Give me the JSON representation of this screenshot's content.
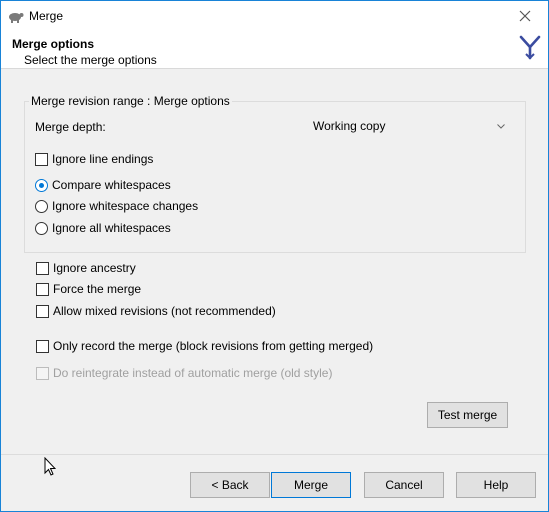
{
  "window": {
    "title": "Merge",
    "app_icon": "tortoise-icon",
    "close_icon": "close-icon"
  },
  "header": {
    "title": "Merge options",
    "subtitle": "Select the merge options",
    "logo_icon": "merge-arrows-icon"
  },
  "group": {
    "legend": "Merge revision range : Merge options",
    "depth_label": "Merge depth:",
    "depth_value": "Working copy",
    "ignore_line_endings": "Ignore line endings",
    "radio_compare": "Compare whitespaces",
    "radio_ignore_changes": "Ignore whitespace changes",
    "radio_ignore_all": "Ignore all whitespaces"
  },
  "options": {
    "ignore_ancestry": "Ignore ancestry",
    "force_merge": "Force the merge",
    "allow_mixed": "Allow mixed revisions (not recommended)",
    "only_record": "Only record the merge (block revisions from getting merged)",
    "reintegrate": "Do reintegrate instead of automatic merge (old style)"
  },
  "buttons": {
    "test_merge": "Test merge",
    "back": "< Back",
    "merge": "Merge",
    "cancel": "Cancel",
    "help": "Help"
  },
  "colors": {
    "accent": "#0078d7",
    "dialog_bg": "#f0f0f0",
    "logo": "#3b4ca0"
  }
}
